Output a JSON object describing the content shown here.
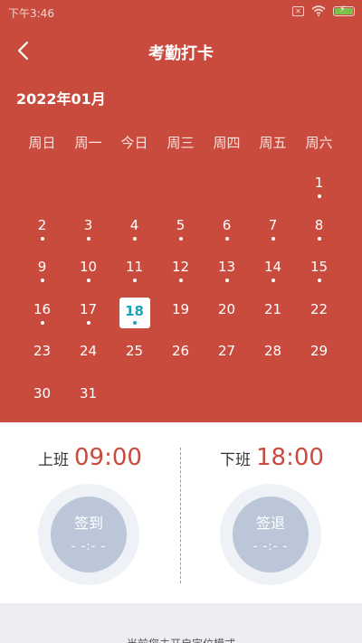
{
  "status_bar": {
    "time": "下午3:46",
    "battery_percent": 100
  },
  "header": {
    "title": "考勤打卡"
  },
  "calendar": {
    "month_label": "2022年01月",
    "weekdays": [
      "周日",
      "周一",
      "今日",
      "周三",
      "周四",
      "周五",
      "周六"
    ],
    "leading_blanks": 6,
    "days": [
      {
        "day": "1",
        "dot": true
      },
      {
        "day": "2",
        "dot": true
      },
      {
        "day": "3",
        "dot": true
      },
      {
        "day": "4",
        "dot": true
      },
      {
        "day": "5",
        "dot": true
      },
      {
        "day": "6",
        "dot": true
      },
      {
        "day": "7",
        "dot": true
      },
      {
        "day": "8",
        "dot": true
      },
      {
        "day": "9",
        "dot": true
      },
      {
        "day": "10",
        "dot": true
      },
      {
        "day": "11",
        "dot": true
      },
      {
        "day": "12",
        "dot": true
      },
      {
        "day": "13",
        "dot": true
      },
      {
        "day": "14",
        "dot": true
      },
      {
        "day": "15",
        "dot": true
      },
      {
        "day": "16",
        "dot": true
      },
      {
        "day": "17",
        "dot": true
      },
      {
        "day": "18",
        "dot": true,
        "today": true
      },
      {
        "day": "19",
        "dot": false
      },
      {
        "day": "20",
        "dot": false
      },
      {
        "day": "21",
        "dot": false
      },
      {
        "day": "22",
        "dot": false
      },
      {
        "day": "23",
        "dot": false
      },
      {
        "day": "24",
        "dot": false
      },
      {
        "day": "25",
        "dot": false
      },
      {
        "day": "26",
        "dot": false
      },
      {
        "day": "27",
        "dot": false
      },
      {
        "day": "28",
        "dot": false
      },
      {
        "day": "29",
        "dot": false
      },
      {
        "day": "30",
        "dot": false
      },
      {
        "day": "31",
        "dot": false
      }
    ]
  },
  "check_in": {
    "label": "上班",
    "time": "09:00",
    "button_label": "签到",
    "button_time": "- -:- -"
  },
  "check_out": {
    "label": "下班",
    "time": "18:00",
    "button_label": "签退",
    "button_time": "- -:- -"
  },
  "footer": {
    "text": "当前您未开启定位模式"
  },
  "colors": {
    "primary": "#c84b3d",
    "today_accent": "#1aa3b5",
    "button_gray": "#bbc6d8"
  }
}
